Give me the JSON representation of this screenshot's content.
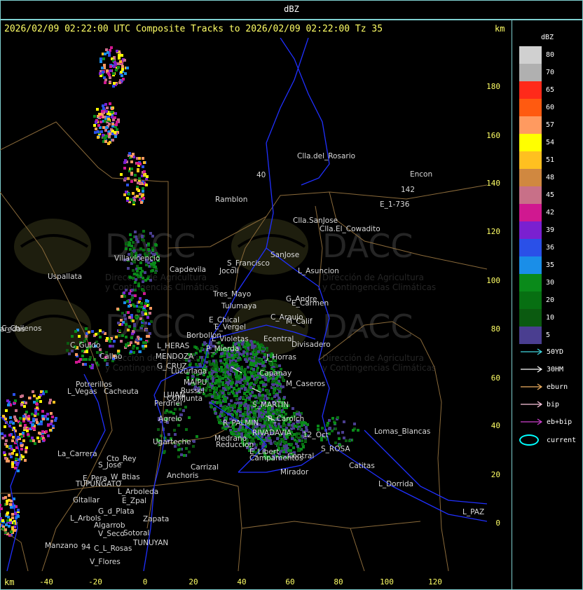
{
  "top_title": "dBZ",
  "header": "2026/02/09 02:22:00 UTC Composite Tracks to 2026/02/09 02:22:00 Tz 35",
  "units": {
    "km_top": "km",
    "km_bottom": "km"
  },
  "y_ticks": [
    "180",
    "160",
    "140",
    "120",
    "100",
    "80",
    "60",
    "40",
    "20",
    "0"
  ],
  "x_ticks": [
    "-40",
    "-20",
    "0",
    "20",
    "40",
    "60",
    "80",
    "100",
    "120"
  ],
  "legend": {
    "title": "dBZ",
    "scale": [
      {
        "label": "80",
        "color": "#d0d0d0"
      },
      {
        "label": "70",
        "color": "#b0b0b0"
      },
      {
        "label": "65",
        "color": "#ff2a1a"
      },
      {
        "label": "60",
        "color": "#ff5a10"
      },
      {
        "label": "57",
        "color": "#ff9a60"
      },
      {
        "label": "54",
        "color": "#ffff00"
      },
      {
        "label": "51",
        "color": "#ffc020"
      },
      {
        "label": "48",
        "color": "#d08840"
      },
      {
        "label": "45",
        "color": "#c87088"
      },
      {
        "label": "42",
        "color": "#d01890"
      },
      {
        "label": "39",
        "color": "#7a20d0"
      },
      {
        "label": "36",
        "color": "#2a50e8"
      },
      {
        "label": "35",
        "color": "#1a8ee8"
      },
      {
        "label": "30",
        "color": "#0a8a1a"
      },
      {
        "label": "20",
        "color": "#076f12"
      },
      {
        "label": "10",
        "color": "#0b5a10"
      },
      {
        "label": "5",
        "color": "#4a3e90"
      }
    ],
    "tracks": [
      {
        "label": "50YD",
        "color": "#40d8e0"
      },
      {
        "label": "30HM",
        "color": "#ffffff"
      },
      {
        "label": "eburn",
        "color": "#f0b060"
      },
      {
        "label": "bip",
        "color": "#ffc8e0"
      },
      {
        "label": "eb+bip",
        "color": "#d040d0"
      }
    ],
    "current_label": "current"
  },
  "watermark": {
    "brand": "DACC",
    "line1": "Dirección de Agricultura",
    "line2": "y Contingencias Climáticas"
  },
  "places": [
    {
      "name": "Clla.del_Rosario"
    },
    {
      "name": "Encon"
    },
    {
      "name": "142"
    },
    {
      "name": "E_1-736"
    },
    {
      "name": "Ramblon"
    },
    {
      "name": "40"
    },
    {
      "name": "Clla.SanJose"
    },
    {
      "name": "Clla.El_Cowadito"
    },
    {
      "name": "Villavicencio"
    },
    {
      "name": "Capdevila"
    },
    {
      "name": "S_Francisco"
    },
    {
      "name": "SanJose"
    },
    {
      "name": "Jocoli"
    },
    {
      "name": "L_Asuncion"
    },
    {
      "name": "Uspallata"
    },
    {
      "name": "Tres_Mayo"
    },
    {
      "name": "Tulumaya"
    },
    {
      "name": "G_Andre"
    },
    {
      "name": "E_Carmen"
    },
    {
      "name": "C_Chilenos"
    },
    {
      "name": "E_Chical"
    },
    {
      "name": "E_Vergel"
    },
    {
      "name": "C_Araujo"
    },
    {
      "name": "M_Calif"
    },
    {
      "name": "aredas"
    },
    {
      "name": "Borbollon"
    },
    {
      "name": "L_Violetas"
    },
    {
      "name": "Ecentral"
    },
    {
      "name": "Divisadero"
    },
    {
      "name": "C_Guido"
    },
    {
      "name": "L_HERAS"
    },
    {
      "name": "P_Mierda"
    },
    {
      "name": "Callao"
    },
    {
      "name": "MENDOZA"
    },
    {
      "name": "J_Horras"
    },
    {
      "name": "G_CRUZ"
    },
    {
      "name": "Luzuriaga"
    },
    {
      "name": "Capanay"
    },
    {
      "name": "Potrerillos"
    },
    {
      "name": "MAIPU"
    },
    {
      "name": "L_Vegas"
    },
    {
      "name": "Cacheuta"
    },
    {
      "name": "Russel"
    },
    {
      "name": "M_Caseros"
    },
    {
      "name": "LUJAN"
    },
    {
      "name": "CUMJunta"
    },
    {
      "name": "Perdriel"
    },
    {
      "name": "S_MARTIN"
    },
    {
      "name": "Agrelo"
    },
    {
      "name": "R_Carolch"
    },
    {
      "name": "R_PALMIN"
    },
    {
      "name": "Lomas_Blancas"
    },
    {
      "name": "RIVADAVIA"
    },
    {
      "name": "12_Oct"
    },
    {
      "name": "Ugarteche"
    },
    {
      "name": "Medrano"
    },
    {
      "name": "Reduccion"
    },
    {
      "name": "S_ROSA"
    },
    {
      "name": "La_Carrera"
    },
    {
      "name": "Cto_Rey"
    },
    {
      "name": "S_Jose"
    },
    {
      "name": "E_Libert"
    },
    {
      "name": "Central"
    },
    {
      "name": "Campamentos"
    },
    {
      "name": "Catitas"
    },
    {
      "name": "Carrizal"
    },
    {
      "name": "Anchoris"
    },
    {
      "name": "E_Pera"
    },
    {
      "name": "W_Btias"
    },
    {
      "name": "Mirador"
    },
    {
      "name": "TUPUNGATO"
    },
    {
      "name": "L_Dorrida"
    },
    {
      "name": "L_Arboleda"
    },
    {
      "name": "E_Zpal"
    },
    {
      "name": "Gltallar"
    },
    {
      "name": "G_d_Plata"
    },
    {
      "name": "L_PAZ"
    },
    {
      "name": "L_Arbols"
    },
    {
      "name": "Zapata"
    },
    {
      "name": "Algarrob"
    },
    {
      "name": "V_Seco"
    },
    {
      "name": "Sotoral"
    },
    {
      "name": "TUNUYAN"
    },
    {
      "name": "Manzano"
    },
    {
      "name": "94"
    },
    {
      "name": "C_L_Rosas"
    },
    {
      "name": "V_Flores"
    }
  ]
}
